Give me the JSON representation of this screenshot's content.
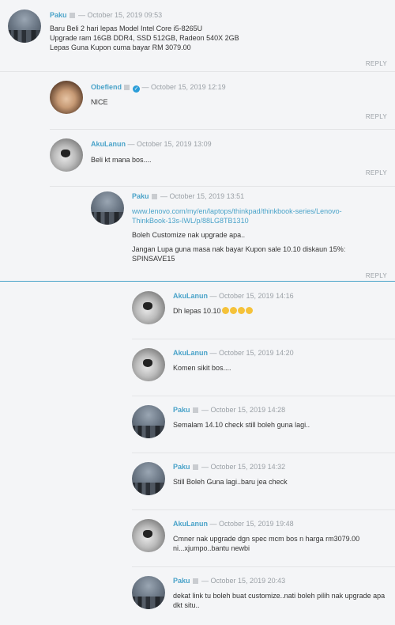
{
  "reply_label": "REPLY",
  "comments": [
    {
      "author": "Paku",
      "date": "— October 15, 2019 09:53",
      "lines": [
        "Baru Beli 2 hari lepas Model Intel Core i5-8265U",
        "Upgrade ram 16GB DDR4, SSD 512GB, Radeon 540X 2GB",
        "Lepas Guna Kupon cuma bayar RM 3079.00"
      ]
    },
    {
      "author": "Obefiend",
      "date": "— October 15, 2019 12:19",
      "lines": [
        "NICE"
      ]
    },
    {
      "author": "AkuLanun",
      "date": "— October 15, 2019 13:09",
      "lines": [
        "Beli kt mana bos...."
      ]
    },
    {
      "author": "Paku",
      "date": "— October 15, 2019 13:51",
      "link": "www.lenovo.com/my/en/laptops/thinkpad/thinkbook-series/Lenovo-ThinkBook-13s-IWL/p/88LG8TB1310",
      "lines": [
        "Boleh Customize nak upgrade apa..",
        "Jangan Lupa guna masa nak bayar Kupon sale 10.10 diskaun 15%: SPINSAVE15"
      ]
    },
    {
      "author": "AkuLanun",
      "date": "— October 15, 2019 14:16",
      "lines": [
        "Dh lepas 10.10"
      ]
    },
    {
      "author": "AkuLanun",
      "date": "— October 15, 2019 14:20",
      "lines": [
        "Komen sikit bos...."
      ]
    },
    {
      "author": "Paku",
      "date": "— October 15, 2019 14:28",
      "lines": [
        "Semalam 14.10 check still boleh guna lagi.."
      ]
    },
    {
      "author": "Paku",
      "date": "— October 15, 2019 14:32",
      "lines": [
        "Still Boleh Guna lagi..baru jea check"
      ]
    },
    {
      "author": "AkuLanun",
      "date": "— October 15, 2019 19:48",
      "lines": [
        "Cmner nak upgrade dgn spec mcm bos n harga rm3079.00 ni...xjumpo..bantu newbi"
      ]
    },
    {
      "author": "Paku",
      "date": "— October 15, 2019 20:43",
      "lines": [
        "dekat link tu boleh buat customize..nati boleh pilih nak upgrade apa dkt situ.."
      ]
    }
  ]
}
